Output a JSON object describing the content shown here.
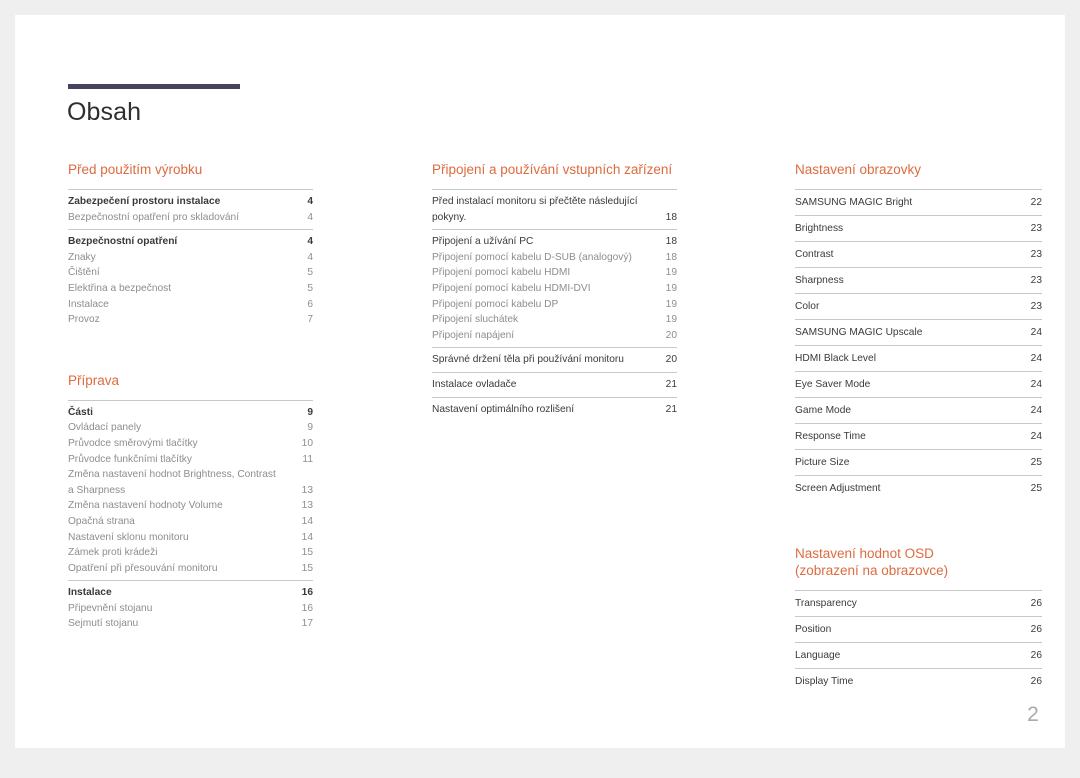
{
  "document": {
    "title": "Obsah",
    "folio": "2",
    "accent_color": "#de6a3f",
    "rule_color": "#46435a",
    "text_color": "#3a3a3e",
    "muted_color": "#8d8d92"
  },
  "columns": [
    {
      "id": "column-1",
      "sections": [
        {
          "title": "Před použitím výrobku",
          "style": "grouped",
          "groups": [
            {
              "entries": [
                {
                  "label": "Zabezpečení prostoru instalace",
                  "page": "4",
                  "level": "head"
                },
                {
                  "label": "Bezpečnostní opatření pro skladování",
                  "page": "4",
                  "level": "sub"
                }
              ]
            },
            {
              "entries": [
                {
                  "label": "Bezpečnostní opatření",
                  "page": "4",
                  "level": "head"
                },
                {
                  "label": "Znaky",
                  "page": "4",
                  "level": "sub"
                },
                {
                  "label": "Čištění",
                  "page": "5",
                  "level": "sub"
                },
                {
                  "label": "Elektřina a bezpečnost",
                  "page": "5",
                  "level": "sub"
                },
                {
                  "label": "Instalace",
                  "page": "6",
                  "level": "sub"
                },
                {
                  "label": "Provoz",
                  "page": "7",
                  "level": "sub"
                }
              ]
            }
          ]
        },
        {
          "title": "Příprava",
          "style": "grouped",
          "groups": [
            {
              "entries": [
                {
                  "label": "Části",
                  "page": "9",
                  "level": "head"
                },
                {
                  "label": "Ovládací panely",
                  "page": "9",
                  "level": "sub"
                },
                {
                  "label": "Průvodce směrovými tlačítky",
                  "page": "10",
                  "level": "sub"
                },
                {
                  "label": "Průvodce funkčními tlačítky",
                  "page": "11",
                  "level": "sub"
                },
                {
                  "label": "Změna nastavení hodnot Brightness, Contrast a Sharpness",
                  "page": "13",
                  "level": "sub"
                },
                {
                  "label": "Změna nastavení hodnoty Volume",
                  "page": "13",
                  "level": "sub"
                },
                {
                  "label": "Opačná strana",
                  "page": "14",
                  "level": "sub"
                },
                {
                  "label": "Nastavení sklonu monitoru",
                  "page": "14",
                  "level": "sub"
                },
                {
                  "label": "Zámek proti krádeži",
                  "page": "15",
                  "level": "sub"
                },
                {
                  "label": "Opatření při přesouvání monitoru",
                  "page": "15",
                  "level": "sub"
                }
              ]
            },
            {
              "entries": [
                {
                  "label": "Instalace",
                  "page": "16",
                  "level": "head"
                },
                {
                  "label": "Připevnění stojanu",
                  "page": "16",
                  "level": "sub"
                },
                {
                  "label": "Sejmutí stojanu",
                  "page": "17",
                  "level": "sub"
                }
              ]
            }
          ]
        }
      ]
    },
    {
      "id": "column-2",
      "sections": [
        {
          "title": "Připojení a používání vstupních zařízení",
          "style": "grouped",
          "groups": [
            {
              "entries": [
                {
                  "label": "Před instalací monitoru si přečtěte následující pokyny.",
                  "page": "18",
                  "level": "head"
                }
              ]
            },
            {
              "entries": [
                {
                  "label": "Připojení a užívání PC",
                  "page": "18",
                  "level": "head"
                },
                {
                  "label": "Připojení pomocí kabelu D-SUB (analogový)",
                  "page": "18",
                  "level": "sub"
                },
                {
                  "label": "Připojení pomocí kabelu HDMI",
                  "page": "19",
                  "level": "sub"
                },
                {
                  "label": "Připojení pomocí kabelu HDMI-DVI",
                  "page": "19",
                  "level": "sub"
                },
                {
                  "label": "Připojení pomocí kabelu DP",
                  "page": "19",
                  "level": "sub"
                },
                {
                  "label": "Připojení sluchátek",
                  "page": "19",
                  "level": "sub"
                },
                {
                  "label": "Připojení napájení",
                  "page": "20",
                  "level": "sub"
                }
              ]
            },
            {
              "entries": [
                {
                  "label": "Správné držení těla při používání monitoru",
                  "page": "20",
                  "level": "head"
                }
              ]
            },
            {
              "entries": [
                {
                  "label": "Instalace ovladače",
                  "page": "21",
                  "level": "head"
                }
              ]
            },
            {
              "entries": [
                {
                  "label": "Nastavení optimálního rozlišení",
                  "page": "21",
                  "level": "head"
                }
              ]
            }
          ]
        }
      ]
    },
    {
      "id": "column-3",
      "sections": [
        {
          "title": "Nastavení obrazovky",
          "style": "ruled",
          "rows": [
            {
              "label": "SAMSUNG MAGIC Bright",
              "page": "22"
            },
            {
              "label": "Brightness",
              "page": "23"
            },
            {
              "label": "Contrast",
              "page": "23"
            },
            {
              "label": "Sharpness",
              "page": "23"
            },
            {
              "label": "Color",
              "page": "23"
            },
            {
              "label": "SAMSUNG MAGIC Upscale",
              "page": "24"
            },
            {
              "label": "HDMI Black Level",
              "page": "24"
            },
            {
              "label": "Eye Saver Mode",
              "page": "24"
            },
            {
              "label": "Game Mode",
              "page": "24"
            },
            {
              "label": "Response Time",
              "page": "24"
            },
            {
              "label": "Picture Size",
              "page": "25"
            },
            {
              "label": "Screen Adjustment",
              "page": "25"
            }
          ]
        },
        {
          "title": "Nastavení hodnot OSD\n(zobrazení na obrazovce)",
          "style": "ruled",
          "rows": [
            {
              "label": "Transparency",
              "page": "26"
            },
            {
              "label": "Position",
              "page": "26"
            },
            {
              "label": "Language",
              "page": "26"
            },
            {
              "label": "Display Time",
              "page": "26"
            }
          ]
        }
      ]
    }
  ]
}
